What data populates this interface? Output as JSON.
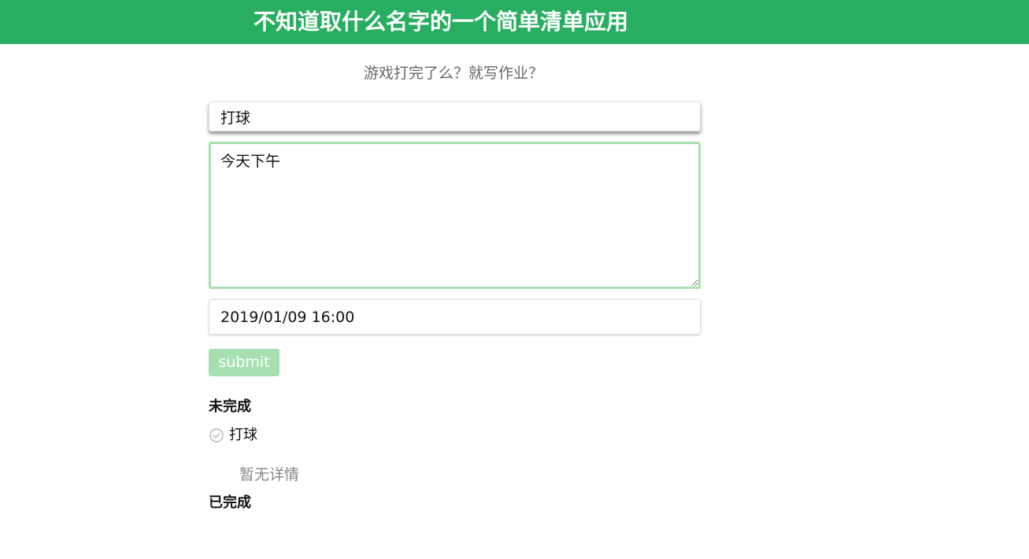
{
  "header": {
    "title": "不知道取什么名字的一个简单清单应用"
  },
  "subtitle": "游戏打完了么？就写作业？",
  "form": {
    "title_value": "打球",
    "detail_value": "今天下午",
    "date_value": "2019/01/09 16:00",
    "submit_label": "submit"
  },
  "sections": {
    "pending_heading": "未完成",
    "done_heading": "已完成"
  },
  "pending_items": [
    {
      "label": "打球",
      "detail": "暂无详情",
      "icon": "check-circle-icon"
    }
  ],
  "colors": {
    "header_bg": "#27ae60",
    "accent_light": "#a7e0b0"
  }
}
